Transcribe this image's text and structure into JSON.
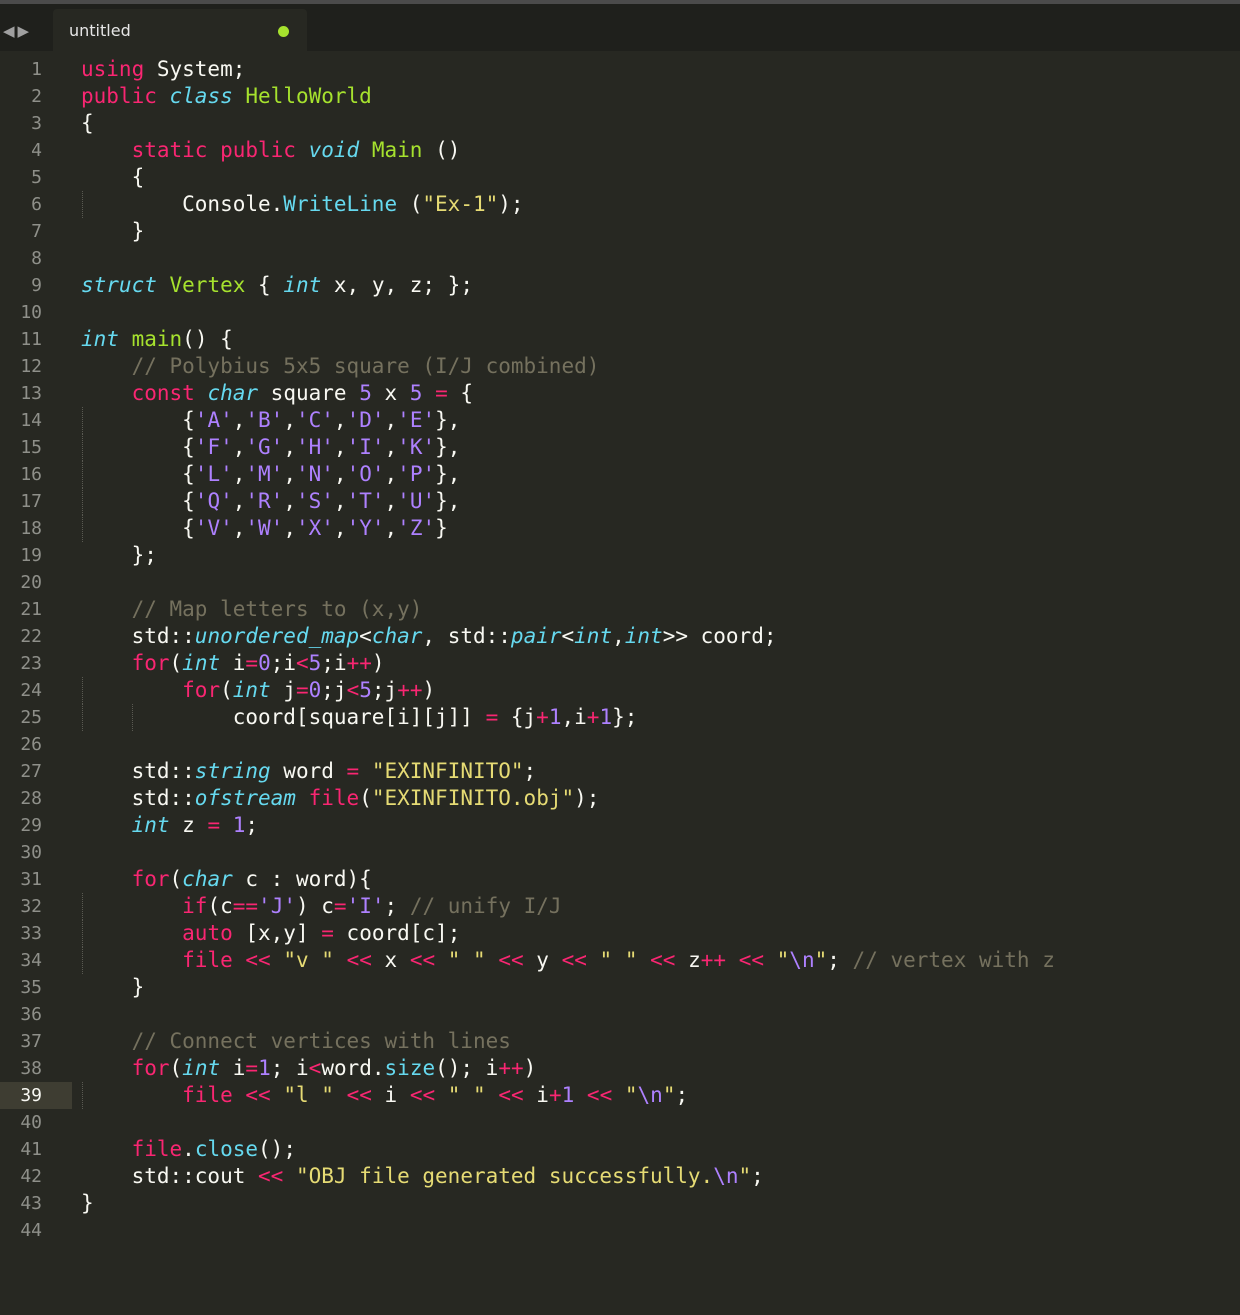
{
  "tabbar": {
    "nav_back": "◀",
    "nav_forward": "▶",
    "tab_title": "untitled",
    "modified_color": "#a6e22e"
  },
  "gutter": {
    "active_line": 39,
    "line_numbers": [
      "1",
      "2",
      "3",
      "4",
      "5",
      "6",
      "7",
      "8",
      "9",
      "10",
      "11",
      "12",
      "13",
      "14",
      "15",
      "16",
      "17",
      "18",
      "19",
      "20",
      "21",
      "22",
      "23",
      "24",
      "25",
      "26",
      "27",
      "28",
      "29",
      "30",
      "31",
      "32",
      "33",
      "34",
      "35",
      "36",
      "37",
      "38",
      "39",
      "40",
      "41",
      "42",
      "43",
      "44"
    ]
  },
  "theme": {
    "background": "#272822",
    "keyword": "#f92672",
    "type": "#66d9ef",
    "function": "#a6e22e",
    "comment": "#75715e",
    "string": "#e6db74",
    "number": "#ae81ff"
  },
  "code_lines": [
    "using System;",
    "public class HelloWorld",
    "{",
    "    static public void Main ()",
    "    {",
    "        Console.WriteLine (\"Ex-1\");",
    "    }",
    "",
    "struct Vertex { int x, y, z; };",
    "",
    "int main() {",
    "    // Polybius 5x5 square (I/J combined)",
    "    const char square 5 x 5 = {",
    "        {'A','B','C','D','E'},",
    "        {'F','G','H','I','K'},",
    "        {'L','M','N','O','P'},",
    "        {'Q','R','S','T','U'},",
    "        {'V','W','X','Y','Z'}",
    "    };",
    "",
    "    // Map letters to (x,y)",
    "    std::unordered_map<char, std::pair<int,int>> coord;",
    "    for(int i=0;i<5;i++)",
    "        for(int j=0;j<5;j++)",
    "            coord[square[i][j]] = {j+1,i+1};",
    "",
    "    std::string word = \"EXINFINITO\";",
    "    std::ofstream file(\"EXINFINITO.obj\");",
    "    int z = 1;",
    "",
    "    for(char c : word){",
    "        if(c=='J') c='I'; // unify I/J",
    "        auto [x,y] = coord[c];",
    "        file << \"v \" << x << \" \" << y << \" \" << z++ << \"\\n\"; // vertex with z",
    "    }",
    "",
    "    // Connect vertices with lines",
    "    for(int i=1; i<word.size(); i++)",
    "        file << \"l \" << i << \" \" << i+1 << \"\\n\";",
    "",
    "    file.close();",
    "    std::cout << \"OBJ file generated successfully.\\n\";",
    "}",
    ""
  ]
}
